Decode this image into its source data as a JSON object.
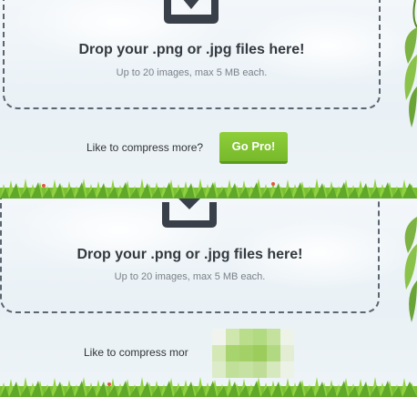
{
  "top_panel": {
    "title": "Drop your .png or .jpg files here!",
    "subtitle": "Up to 20 images, max 5 MB each.",
    "promo_text": "Like to compress more?",
    "pro_button_label": "Go Pro!"
  },
  "bottom_panel": {
    "title": "Drop your .png or .jpg files here!",
    "subtitle": "Up to 20 images, max 5 MB each.",
    "promo_text": "Like to compress mor"
  },
  "colors": {
    "pro_button": "#7cc230",
    "dropzone_border": "#5c6670",
    "icon": "#3a4049"
  },
  "icons": [
    "upload-tray-icon",
    "leaf-icon",
    "grass-border"
  ]
}
